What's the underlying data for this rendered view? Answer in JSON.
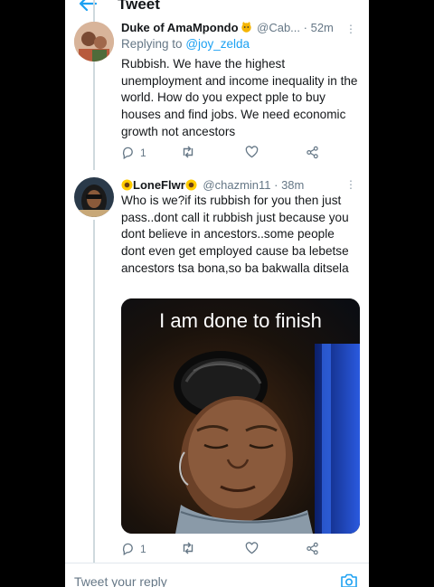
{
  "header": {
    "title": "Tweet"
  },
  "tweet1": {
    "name": "Duke of AmaMpondo",
    "handle": "@Cab...",
    "time": "· 52m",
    "replying_prefix": "Replying to",
    "replying_handle": "@joy_zelda",
    "text": "Rubbish. We have the highest unemployment and income inequality in the world. How do you expect pple to buy houses and find jobs. We need economic growth not ancestors",
    "reply_count": "1"
  },
  "tweet2": {
    "name": "LoneFlwr",
    "handle": "@chazmin11",
    "time": "· 38m",
    "text": "Who is we?if its rubbish for you then just pass..dont call it rubbish just because you dont believe in ancestors..some people  dont even get employed cause ba lebetse ancestors tsa bona,so ba bakwalla ditsela",
    "meme_caption": "I am done to finish",
    "reply_count": "1"
  },
  "reply_bar": {
    "placeholder": "Tweet your reply"
  },
  "colors": {
    "accent": "#1da1f2",
    "text": "#14171a",
    "muted": "#657786"
  },
  "icons": [
    "back-arrow-icon",
    "more-icon",
    "reply-icon",
    "retweet-icon",
    "like-icon",
    "share-icon",
    "camera-icon",
    "sunflower-emoji-icon",
    "pouting-cat-emoji-icon"
  ]
}
